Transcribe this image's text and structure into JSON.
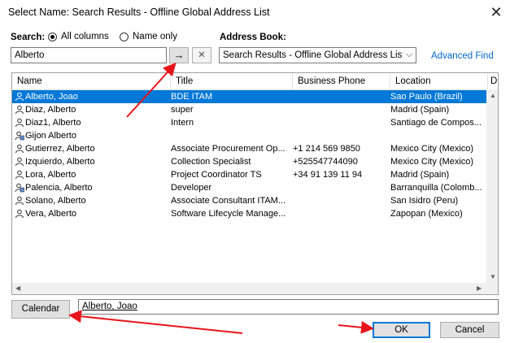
{
  "window": {
    "title": "Select Name: Search Results - Offline Global Address List"
  },
  "search": {
    "label": "Search:",
    "option_all": "All columns",
    "option_name": "Name only",
    "value": "Alberto"
  },
  "address_book": {
    "label": "Address Book:",
    "selected": "Search Results - Offline Global Address List",
    "advanced_find": "Advanced Find"
  },
  "table": {
    "columns": [
      "Name",
      "Title",
      "Business Phone",
      "Location",
      "D"
    ],
    "rows": [
      {
        "name": "Alberto, Joao",
        "title": "BDE ITAM",
        "phone": "",
        "location": "Sao Paulo (Brazil)",
        "icon": "person-icon",
        "selected": true
      },
      {
        "name": "Diaz, Alberto",
        "title": "super",
        "phone": "",
        "location": "Madrid (Spain)",
        "icon": "person-icon"
      },
      {
        "name": "Diaz1, Alberto",
        "title": "Intern",
        "phone": "",
        "location": "Santiago de Compos...",
        "icon": "person-icon"
      },
      {
        "name": "Gijon Alberto",
        "title": "",
        "phone": "",
        "location": "",
        "icon": "room-icon"
      },
      {
        "name": "Gutierrez, Alberto",
        "title": "Associate Procurement Op...",
        "phone": "+1 214 569 9850",
        "location": "Mexico City (Mexico)",
        "icon": "person-icon"
      },
      {
        "name": "Izquierdo, Alberto",
        "title": "Collection Specialist",
        "phone": "+525547744090",
        "location": "Mexico City (Mexico)",
        "icon": "person-icon"
      },
      {
        "name": "Lora, Alberto",
        "title": "Project Coordinator TS",
        "phone": "+34 91 139 11 94",
        "location": "Madrid (Spain)",
        "icon": "person-icon"
      },
      {
        "name": "Palencia, Alberto",
        "title": "Developer",
        "phone": "",
        "location": "Barranquilla (Colomb...",
        "icon": "room-icon"
      },
      {
        "name": "Solano, Alberto",
        "title": "Associate Consultant ITAM...",
        "phone": "",
        "location": "San Isidro (Peru)",
        "icon": "person-icon"
      },
      {
        "name": "Vera, Alberto",
        "title": "Software Lifecycle Manage...",
        "phone": "",
        "location": "Zapopan (Mexico)",
        "icon": "person-icon"
      }
    ]
  },
  "footer": {
    "calendar_label": "Calendar",
    "selected_value": "Alberto, Joao",
    "ok_label": "OK",
    "cancel_label": "Cancel"
  },
  "icons": {
    "go_arrow": "→",
    "clear": "✕",
    "close": "✕",
    "dropdown": "⌵"
  },
  "colors": {
    "selection": "#0078d7",
    "link": "#0066cc",
    "annotation": "#e8141b"
  }
}
